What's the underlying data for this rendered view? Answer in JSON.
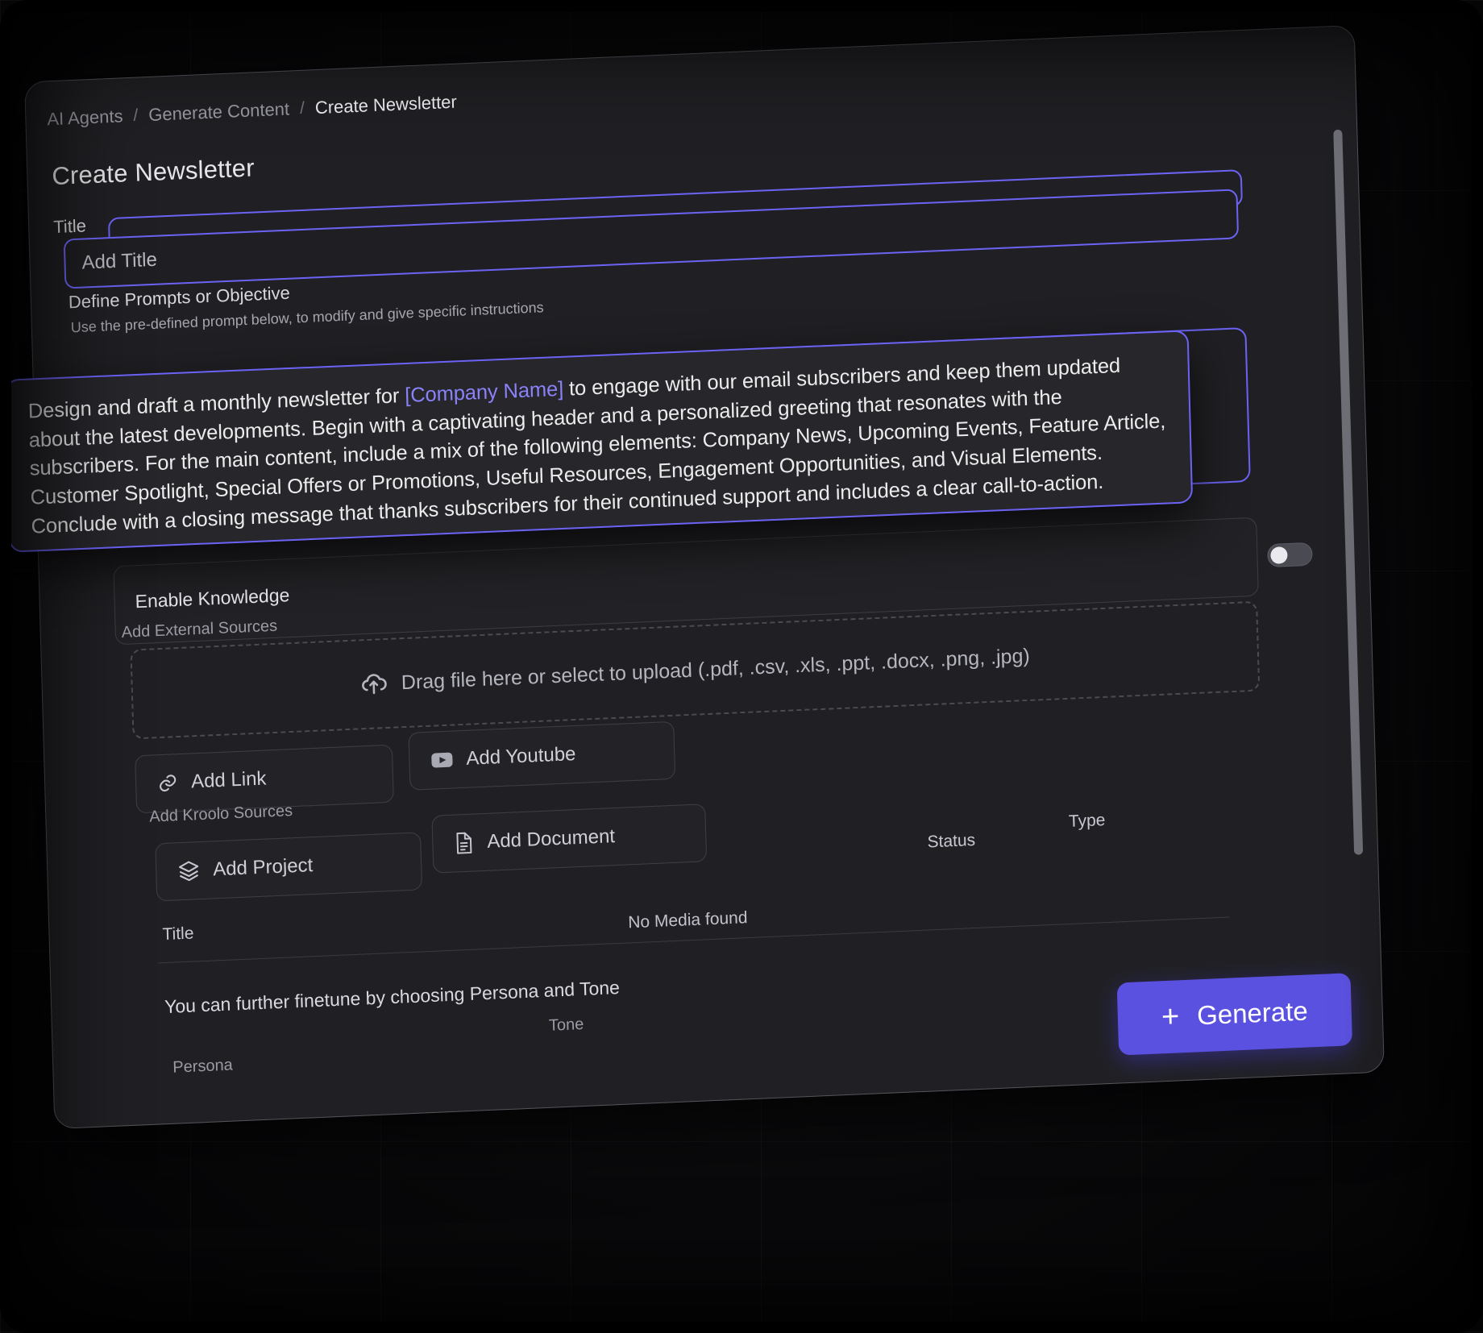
{
  "breadcrumb": {
    "items": [
      {
        "label": "AI Agents",
        "active": false
      },
      {
        "label": "Generate Content",
        "active": false
      },
      {
        "label": "Create Newsletter",
        "active": true
      }
    ],
    "separator": "/"
  },
  "page": {
    "title": "Create Newsletter"
  },
  "title_field": {
    "label": "Title",
    "value": "",
    "placeholder": "Add Title"
  },
  "prompt_field": {
    "label": "Define Prompts or Objective",
    "hint": "Use the pre-defined prompt below, to modify and give specific instructions",
    "text_part_1": "Design and draft a monthly newsletter for ",
    "token": "[Company Name]",
    "text_part_2": " to engage with our email subscribers and keep them updated about the latest developments. Begin with a captivating header and a personalized greeting that resonates with the subscribers. For the main content, include a mix of the following elements: Company News, Upcoming Events, Feature Article, Customer Spotlight, Special Offers or Promotions, Useful Resources, Engagement Opportunities, and Visual Elements. Conclude with a closing message that thanks subscribers for their continued support and includes a clear call-to-action."
  },
  "knowledge": {
    "label": "Enable Knowledge",
    "toggle_state": "off"
  },
  "external_sources": {
    "label": "Add External Sources",
    "dropzone_text": "Drag file here or select to upload (.pdf, .csv, .xls, .ppt, .docx, .png, .jpg)",
    "upload_icon": "upload-cloud-icon",
    "buttons": [
      {
        "label": "Add Link",
        "icon": "link-icon"
      },
      {
        "label": "Add Youtube",
        "icon": "youtube-icon"
      }
    ]
  },
  "kroolo_sources": {
    "label": "Add Kroolo Sources",
    "buttons": [
      {
        "label": "Add Project",
        "icon": "layers-icon"
      },
      {
        "label": "Add Document",
        "icon": "document-icon"
      }
    ]
  },
  "media_table": {
    "columns": [
      "Title",
      "Status",
      "Type"
    ],
    "empty_text": "No Media found"
  },
  "finetune": {
    "text": "You can further finetune by choosing Persona and Tone",
    "persona_label": "Persona",
    "tone_label": "Tone"
  },
  "generate": {
    "label": "Generate",
    "plus": "+"
  },
  "colors": {
    "accent": "#6c63f5",
    "button": "#5b51e0",
    "panel_bg": "#202024",
    "text": "#e8e8ec"
  }
}
